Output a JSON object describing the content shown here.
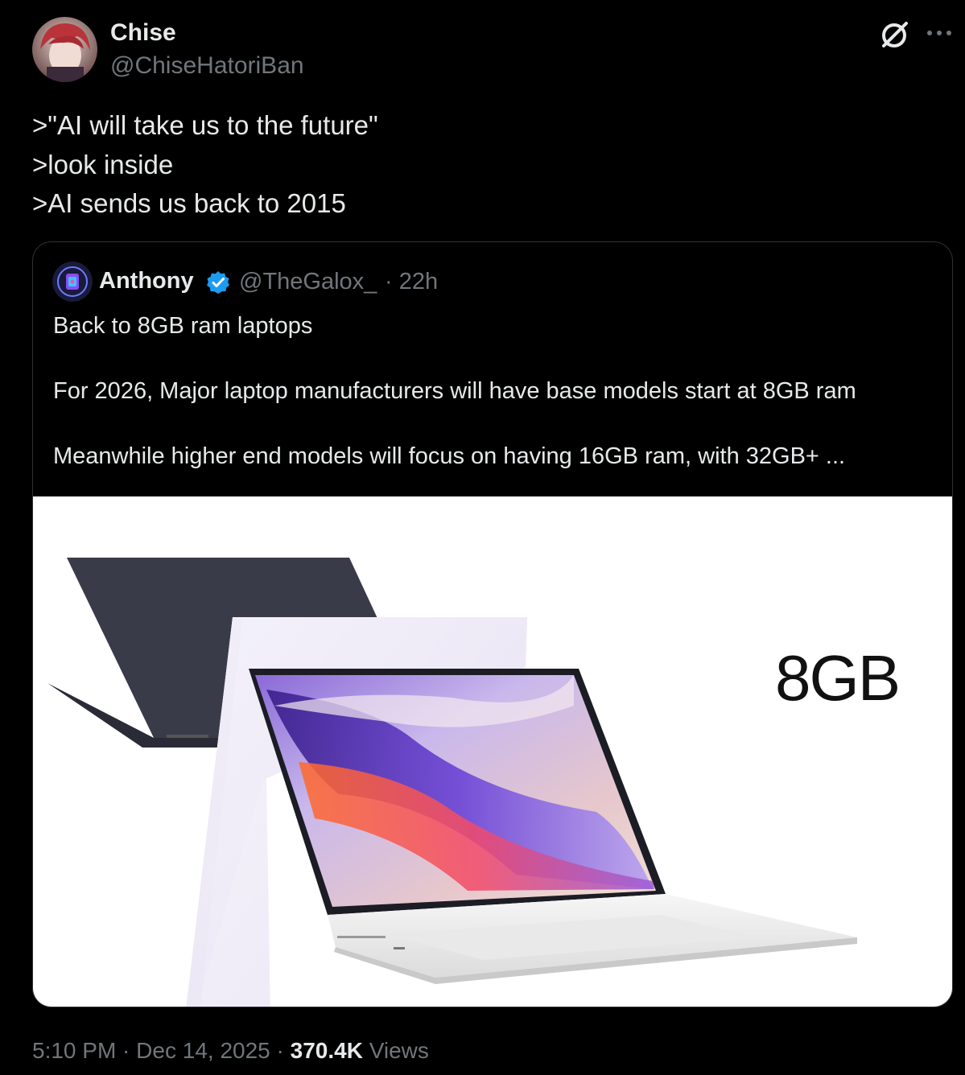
{
  "author": {
    "display_name": "Chise",
    "handle": "@ChiseHatoriBan"
  },
  "tweet": {
    "lines": [
      ">\"AI will take us to the future\"",
      ">look inside",
      ">AI sends us back to 2015"
    ]
  },
  "quoted": {
    "display_name": "Anthony",
    "handle": "@TheGalox_",
    "time": "· 22h",
    "verified": true,
    "lines": [
      "Back to 8GB ram laptops",
      "",
      "For 2026, Major laptop manufacturers will have base models start at 8GB ram",
      "",
      "Meanwhile higher end models will focus on having 16GB ram, with 32GB+ ..."
    ],
    "media": {
      "label": "8GB"
    }
  },
  "meta": {
    "time": "5:10 PM",
    "sep1": " · ",
    "date": "Dec 14, 2025",
    "sep2": " · ",
    "views_count": "370.4K",
    "views_label": " Views"
  },
  "colors": {
    "background": "#000000",
    "text": "#e7e9ea",
    "secondary": "#71767b",
    "border": "#2f3336",
    "verified": "#1d9bf0"
  },
  "icons": [
    "grok-icon",
    "more-icon",
    "verified-badge-icon"
  ]
}
